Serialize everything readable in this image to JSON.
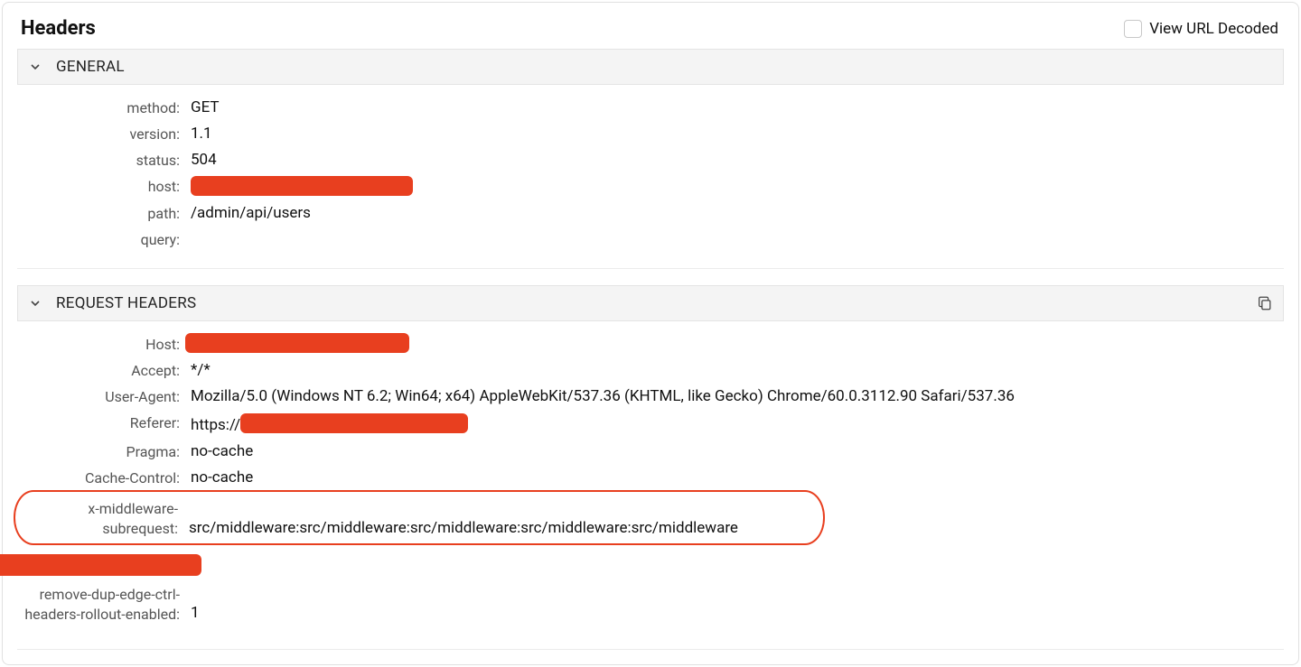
{
  "header": {
    "title": "Headers",
    "view_decoded_label": "View URL Decoded"
  },
  "sections": {
    "general": {
      "title": "GENERAL",
      "rows": {
        "method": {
          "key": "method:",
          "val": "GET"
        },
        "version": {
          "key": "version:",
          "val": "1.1"
        },
        "status": {
          "key": "status:",
          "val": "504"
        },
        "host": {
          "key": "host:",
          "val": ""
        },
        "path": {
          "key": "path:",
          "val": "/admin/api/users"
        },
        "query": {
          "key": "query:",
          "val": ""
        }
      }
    },
    "request_headers": {
      "title": "REQUEST HEADERS",
      "rows": {
        "host": {
          "key": "Host:",
          "val": ""
        },
        "accept": {
          "key": "Accept:",
          "val": "*/*"
        },
        "user_agent": {
          "key": "User-Agent:",
          "val": "Mozilla/5.0 (Windows NT 6.2; Win64; x64) AppleWebKit/537.36 (KHTML, like Gecko) Chrome/60.0.3112.90 Safari/537.36"
        },
        "referer": {
          "key": "Referer:",
          "val_prefix": "https://"
        },
        "pragma": {
          "key": "Pragma:",
          "val": "no-cache"
        },
        "cache_control": {
          "key": "Cache-Control:",
          "val": "no-cache"
        },
        "x_middleware_subrequest": {
          "key": "x-middleware-subrequest:",
          "val": "src/middleware:src/middleware:src/middleware:src/middleware:src/middleware"
        },
        "remove_dup": {
          "key": "remove-dup-edge-ctrl-headers-rollout-enabled:",
          "val": "1"
        }
      }
    }
  }
}
